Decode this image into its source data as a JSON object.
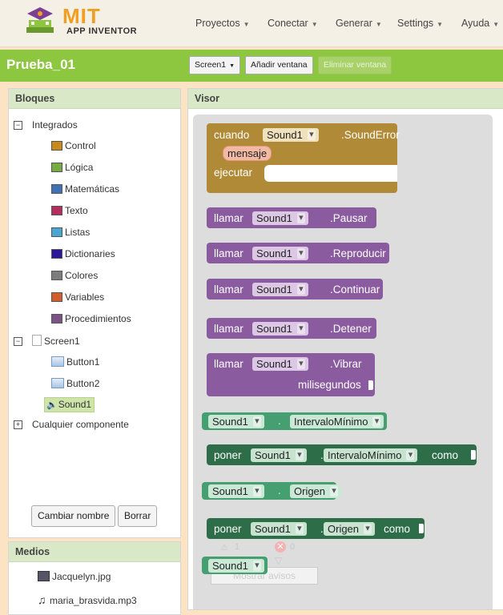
{
  "header": {
    "logo_title": "MIT",
    "logo_subtitle": "APP INVENTOR",
    "menus": [
      {
        "label": "Proyectos"
      },
      {
        "label": "Conectar"
      },
      {
        "label": "Generar"
      },
      {
        "label": "Settings"
      },
      {
        "label": "Ayuda"
      }
    ]
  },
  "project": {
    "name": "Prueba_01",
    "screen_selector": "Screen1",
    "add_screen": "Añadir ventana",
    "remove_screen": "Eliminar ventana"
  },
  "blocks_panel": {
    "title": "Bloques",
    "builtin_label": "Integrados",
    "builtin": [
      {
        "label": "Control",
        "color": "#c88a1b"
      },
      {
        "label": "Lógica",
        "color": "#77ab41"
      },
      {
        "label": "Matemáticas",
        "color": "#3f71b5"
      },
      {
        "label": "Texto",
        "color": "#b32d5e"
      },
      {
        "label": "Listas",
        "color": "#49a6d4"
      },
      {
        "label": "Dictionaries",
        "color": "#2d1799"
      },
      {
        "label": "Colores",
        "color": "#7d7d7d"
      },
      {
        "label": "Variables",
        "color": "#d05f2d"
      },
      {
        "label": "Procedimientos",
        "color": "#7c5385"
      }
    ],
    "screen_label": "Screen1",
    "components": [
      {
        "label": "Button1"
      },
      {
        "label": "Button2"
      },
      {
        "label": "Sound1"
      }
    ],
    "any_component": "Cualquier componente",
    "rename_button": "Cambiar nombre",
    "delete_button": "Borrar"
  },
  "media_panel": {
    "title": "Medios",
    "files": [
      {
        "name": "Jacquelyn.jpg"
      },
      {
        "name": "maria_brasvida.mp3"
      }
    ]
  },
  "viewer": {
    "title": "Visor",
    "warnings_count": "1",
    "errors_count": "0",
    "show_warnings": "Mostrar avisos"
  },
  "blocks": {
    "event": {
      "when": "cuando",
      "component": "Sound1",
      "event": ".SoundError",
      "param": "mensaje",
      "do": "ejecutar"
    },
    "call_label": "llamar",
    "calls": [
      {
        "component": "Sound1",
        "method": ".Pausar"
      },
      {
        "component": "Sound1",
        "method": ".Reproducir"
      },
      {
        "component": "Sound1",
        "method": ".Continuar"
      },
      {
        "component": "Sound1",
        "method": ".Detener"
      },
      {
        "component": "Sound1",
        "method": ".Vibrar",
        "arg": "milisegundos"
      }
    ],
    "set_label": "poner",
    "as_label": "como",
    "properties": [
      {
        "component": "Sound1",
        "property": "IntervaloMínimo"
      },
      {
        "component": "Sound1",
        "property": "Origen"
      }
    ],
    "component_block": "Sound1"
  }
}
